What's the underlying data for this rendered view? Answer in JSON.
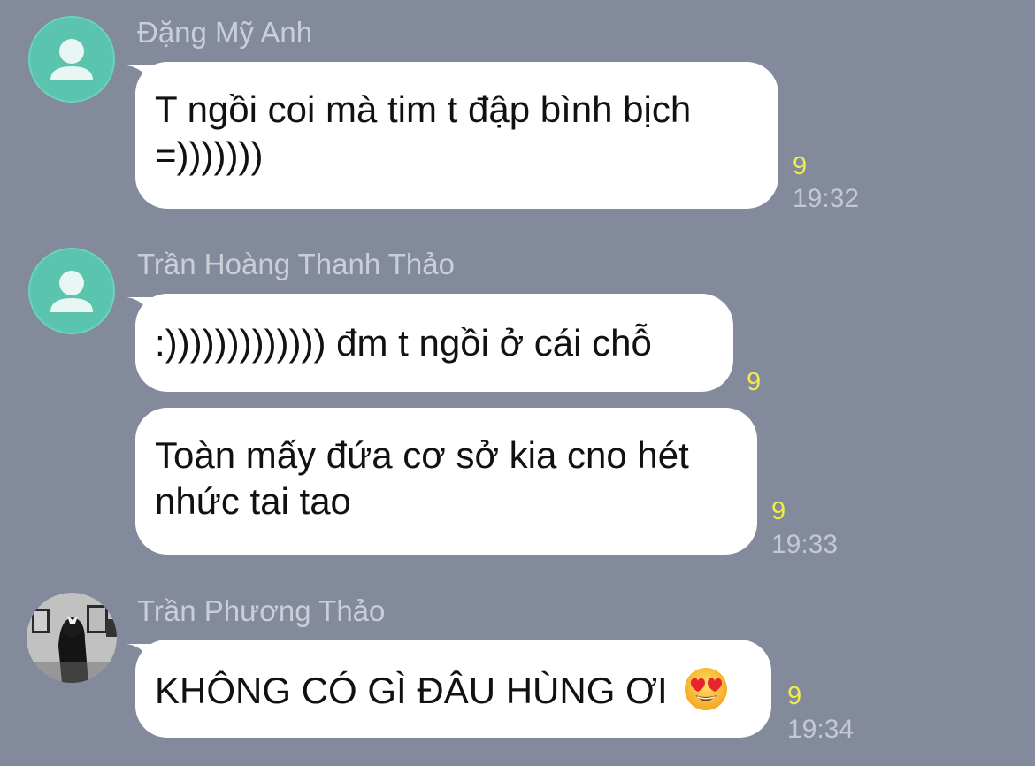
{
  "messages": [
    {
      "sender": "Đặng Mỹ Anh",
      "avatar_icon": "default-person-icon",
      "bubbles": [
        {
          "text": "T ngồi coi mà tim t đập bình bịch =)))))))",
          "read_count": "9",
          "time": "19:32"
        }
      ]
    },
    {
      "sender": "Trần Hoàng Thanh Thảo",
      "avatar_icon": "default-person-icon",
      "bubbles": [
        {
          "text": ":))))))))))))) đm t ngồi ở cái chỗ",
          "read_count": "9",
          "time": ""
        },
        {
          "text": "Toàn mấy đứa cơ sở kia cno hét nhức tai tao",
          "read_count": "9",
          "time": "19:33"
        }
      ]
    },
    {
      "sender": "Trần Phương Thảo",
      "avatar_icon": "profile-photo",
      "bubbles": [
        {
          "text": "KHÔNG CÓ GÌ ĐÂU HÙNG ƠI",
          "emoji": "heart-eyes-emoji",
          "read_count": "9",
          "time": "19:34"
        }
      ]
    }
  ],
  "colors": {
    "background": "#828a9b",
    "bubble": "#ffffff",
    "avatar_default": "#5bc4ae",
    "read_count": "#f2e94a",
    "meta_text": "#c3c8d2"
  }
}
